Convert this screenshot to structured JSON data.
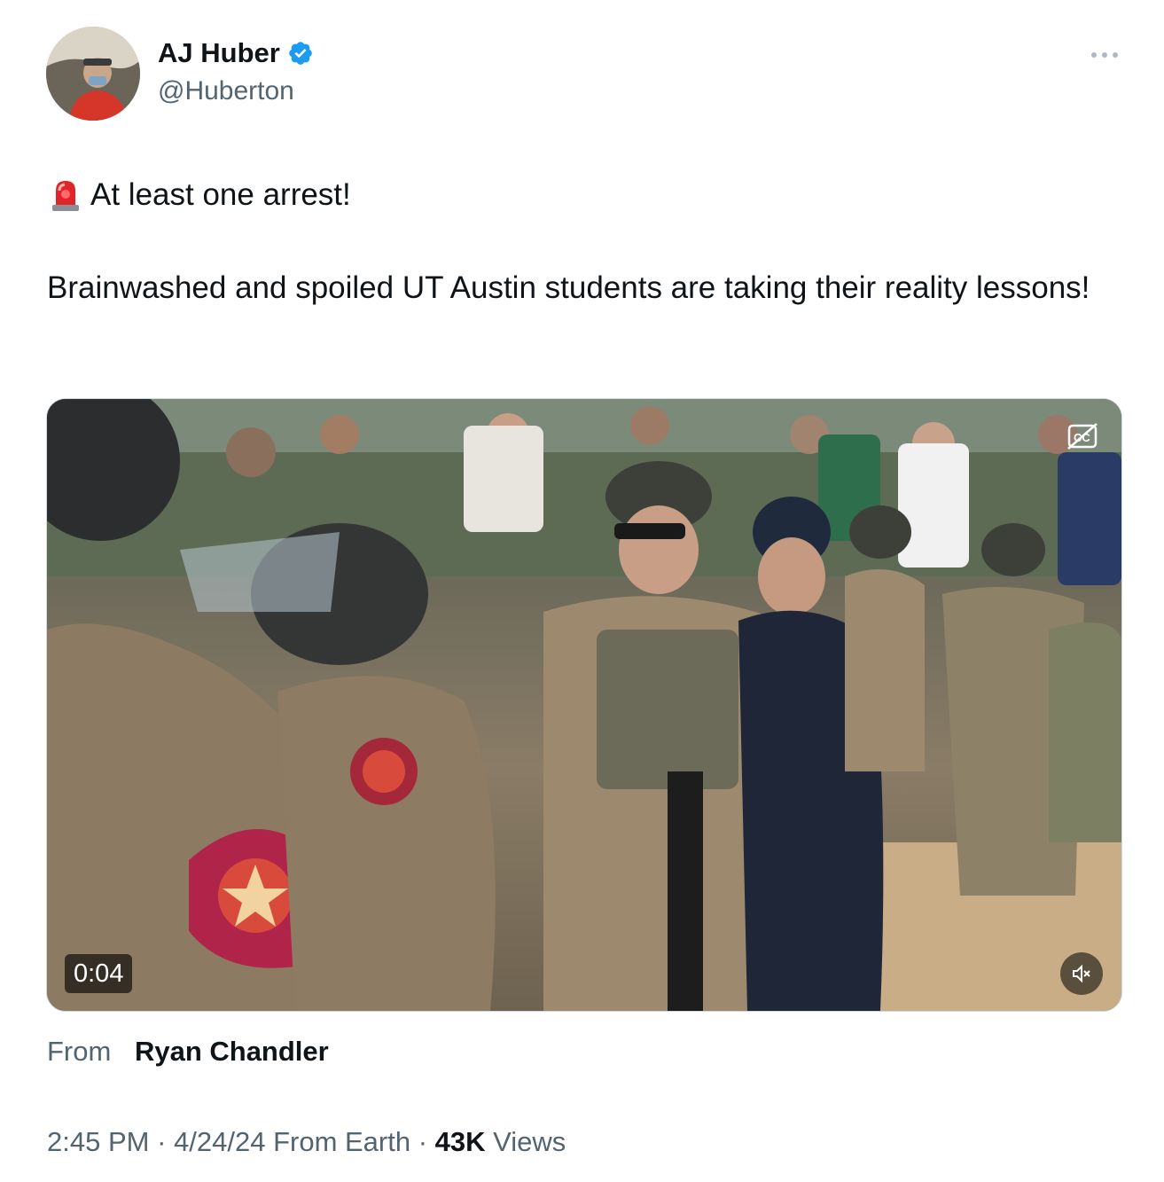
{
  "author": {
    "display_name": "AJ Huber",
    "handle": "@Huberton",
    "verified": true
  },
  "icons": {
    "avatar": "avatar-photo",
    "verified": "verified-badge-icon",
    "more": "more-options-icon",
    "siren": "police-siren-emoji",
    "captions": "captions-icon",
    "mute": "speaker-muted-icon"
  },
  "tweet": {
    "line1": "At least one arrest!",
    "body": "Brainwashed and spoiled UT Austin students are taking their reality lessons!"
  },
  "media": {
    "duration": "0:04"
  },
  "source": {
    "label": "From",
    "name": "Ryan Chandler"
  },
  "meta": {
    "time": "2:45 PM",
    "separator1": " · ",
    "date": "4/24/24",
    "location": " From Earth",
    "separator2": " · ",
    "views_count": "43K",
    "views_label": " Views"
  },
  "colors": {
    "verified": "#1d9bf0",
    "text": "#0f1419",
    "secondary": "#536471"
  }
}
